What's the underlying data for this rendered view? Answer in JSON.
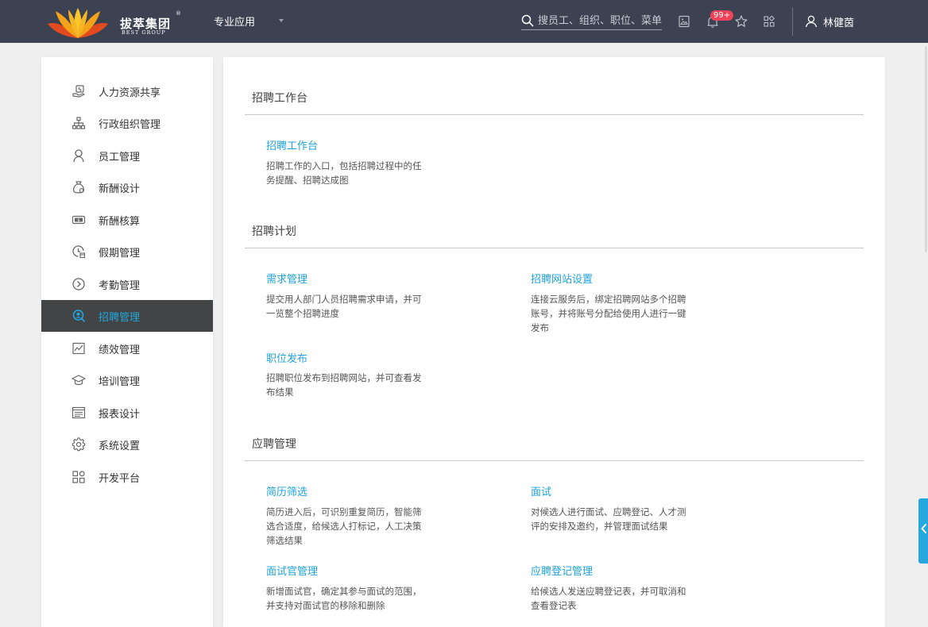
{
  "brand": {
    "name": "拔萃集团",
    "sub": "BEST GROUP",
    "reg": "®"
  },
  "header": {
    "app_menu": "专业应用",
    "search_placeholder": "搜员工、组织、职位、菜单",
    "notification_count": "99+",
    "user_name": "林健茵",
    "colors": {
      "bar": "#3c4251",
      "badge": "#f0435a"
    }
  },
  "sidebar": {
    "active_color": "#21a7dd",
    "items": [
      {
        "label": "人力资源共享",
        "icon": "hand-share-icon"
      },
      {
        "label": "行政组织管理",
        "icon": "org-chart-icon"
      },
      {
        "label": "员工管理",
        "icon": "person-icon"
      },
      {
        "label": "新酬设计",
        "icon": "money-bag-icon"
      },
      {
        "label": "新酬核算",
        "icon": "cash-icon"
      },
      {
        "label": "假期管理",
        "icon": "clock-calendar-icon"
      },
      {
        "label": "考勤管理",
        "icon": "arrow-circle-icon"
      },
      {
        "label": "招聘管理",
        "icon": "recruit-search-icon",
        "active": true
      },
      {
        "label": "绩效管理",
        "icon": "chart-icon"
      },
      {
        "label": "培训管理",
        "icon": "graduation-cap-icon"
      },
      {
        "label": "报表设计",
        "icon": "report-icon"
      },
      {
        "label": "系统设置",
        "icon": "gear-icon"
      },
      {
        "label": "开发平台",
        "icon": "apps-icon"
      }
    ]
  },
  "main": {
    "sections": [
      {
        "title": "招聘工作台",
        "cards": [
          {
            "title": "招聘工作台",
            "desc": "招聘工作的入口，包括招聘过程中的任务提醒、招聘达成图"
          }
        ]
      },
      {
        "title": "招聘计划",
        "cards": [
          {
            "title": "需求管理",
            "desc": "提交用人部门人员招聘需求申请，并可一览整个招聘进度"
          },
          {
            "title": "招聘网站设置",
            "desc": "连接云服务后，绑定招聘网站多个招聘账号，并将账号分配给使用人进行一键发布"
          },
          {
            "title": "职位发布",
            "desc": "招聘职位发布到招聘网站，并可查看发布结果"
          }
        ]
      },
      {
        "title": "应聘管理",
        "cards": [
          {
            "title": "简历筛选",
            "desc": "简历进入后，可识别重复简历，智能筛选合适度，给候选人打标记，人工决策筛选结果"
          },
          {
            "title": "面试",
            "desc": "对候选人进行面试、应聘登记、人才测评的安排及邀约，并管理面试结果"
          },
          {
            "title": "面试官管理",
            "desc": "新增面试官，确定其参与面试的范围，并支持对面试官的移除和删除"
          },
          {
            "title": "应聘登记管理",
            "desc": "给候选人发送应聘登记表，并可取消和查看登记表"
          }
        ]
      }
    ]
  }
}
